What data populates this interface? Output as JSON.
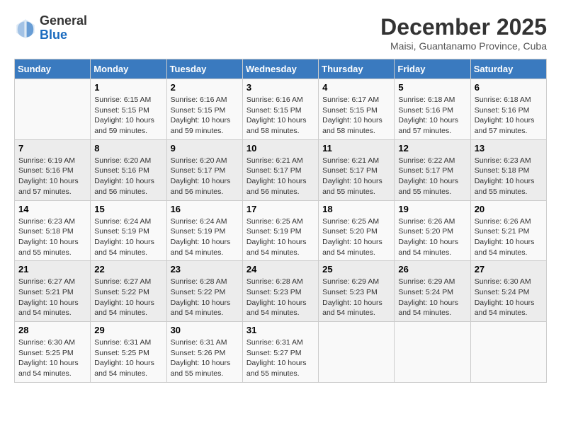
{
  "header": {
    "logo_general": "General",
    "logo_blue": "Blue",
    "title": "December 2025",
    "subtitle": "Maisi, Guantanamo Province, Cuba"
  },
  "days_of_week": [
    "Sunday",
    "Monday",
    "Tuesday",
    "Wednesday",
    "Thursday",
    "Friday",
    "Saturday"
  ],
  "weeks": [
    [
      {
        "day": "",
        "details": ""
      },
      {
        "day": "1",
        "details": "Sunrise: 6:15 AM\nSunset: 5:15 PM\nDaylight: 10 hours\nand 59 minutes."
      },
      {
        "day": "2",
        "details": "Sunrise: 6:16 AM\nSunset: 5:15 PM\nDaylight: 10 hours\nand 59 minutes."
      },
      {
        "day": "3",
        "details": "Sunrise: 6:16 AM\nSunset: 5:15 PM\nDaylight: 10 hours\nand 58 minutes."
      },
      {
        "day": "4",
        "details": "Sunrise: 6:17 AM\nSunset: 5:15 PM\nDaylight: 10 hours\nand 58 minutes."
      },
      {
        "day": "5",
        "details": "Sunrise: 6:18 AM\nSunset: 5:16 PM\nDaylight: 10 hours\nand 57 minutes."
      },
      {
        "day": "6",
        "details": "Sunrise: 6:18 AM\nSunset: 5:16 PM\nDaylight: 10 hours\nand 57 minutes."
      }
    ],
    [
      {
        "day": "7",
        "details": "Sunrise: 6:19 AM\nSunset: 5:16 PM\nDaylight: 10 hours\nand 57 minutes."
      },
      {
        "day": "8",
        "details": "Sunrise: 6:20 AM\nSunset: 5:16 PM\nDaylight: 10 hours\nand 56 minutes."
      },
      {
        "day": "9",
        "details": "Sunrise: 6:20 AM\nSunset: 5:17 PM\nDaylight: 10 hours\nand 56 minutes."
      },
      {
        "day": "10",
        "details": "Sunrise: 6:21 AM\nSunset: 5:17 PM\nDaylight: 10 hours\nand 56 minutes."
      },
      {
        "day": "11",
        "details": "Sunrise: 6:21 AM\nSunset: 5:17 PM\nDaylight: 10 hours\nand 55 minutes."
      },
      {
        "day": "12",
        "details": "Sunrise: 6:22 AM\nSunset: 5:17 PM\nDaylight: 10 hours\nand 55 minutes."
      },
      {
        "day": "13",
        "details": "Sunrise: 6:23 AM\nSunset: 5:18 PM\nDaylight: 10 hours\nand 55 minutes."
      }
    ],
    [
      {
        "day": "14",
        "details": "Sunrise: 6:23 AM\nSunset: 5:18 PM\nDaylight: 10 hours\nand 55 minutes."
      },
      {
        "day": "15",
        "details": "Sunrise: 6:24 AM\nSunset: 5:19 PM\nDaylight: 10 hours\nand 54 minutes."
      },
      {
        "day": "16",
        "details": "Sunrise: 6:24 AM\nSunset: 5:19 PM\nDaylight: 10 hours\nand 54 minutes."
      },
      {
        "day": "17",
        "details": "Sunrise: 6:25 AM\nSunset: 5:19 PM\nDaylight: 10 hours\nand 54 minutes."
      },
      {
        "day": "18",
        "details": "Sunrise: 6:25 AM\nSunset: 5:20 PM\nDaylight: 10 hours\nand 54 minutes."
      },
      {
        "day": "19",
        "details": "Sunrise: 6:26 AM\nSunset: 5:20 PM\nDaylight: 10 hours\nand 54 minutes."
      },
      {
        "day": "20",
        "details": "Sunrise: 6:26 AM\nSunset: 5:21 PM\nDaylight: 10 hours\nand 54 minutes."
      }
    ],
    [
      {
        "day": "21",
        "details": "Sunrise: 6:27 AM\nSunset: 5:21 PM\nDaylight: 10 hours\nand 54 minutes."
      },
      {
        "day": "22",
        "details": "Sunrise: 6:27 AM\nSunset: 5:22 PM\nDaylight: 10 hours\nand 54 minutes."
      },
      {
        "day": "23",
        "details": "Sunrise: 6:28 AM\nSunset: 5:22 PM\nDaylight: 10 hours\nand 54 minutes."
      },
      {
        "day": "24",
        "details": "Sunrise: 6:28 AM\nSunset: 5:23 PM\nDaylight: 10 hours\nand 54 minutes."
      },
      {
        "day": "25",
        "details": "Sunrise: 6:29 AM\nSunset: 5:23 PM\nDaylight: 10 hours\nand 54 minutes."
      },
      {
        "day": "26",
        "details": "Sunrise: 6:29 AM\nSunset: 5:24 PM\nDaylight: 10 hours\nand 54 minutes."
      },
      {
        "day": "27",
        "details": "Sunrise: 6:30 AM\nSunset: 5:24 PM\nDaylight: 10 hours\nand 54 minutes."
      }
    ],
    [
      {
        "day": "28",
        "details": "Sunrise: 6:30 AM\nSunset: 5:25 PM\nDaylight: 10 hours\nand 54 minutes."
      },
      {
        "day": "29",
        "details": "Sunrise: 6:31 AM\nSunset: 5:25 PM\nDaylight: 10 hours\nand 54 minutes."
      },
      {
        "day": "30",
        "details": "Sunrise: 6:31 AM\nSunset: 5:26 PM\nDaylight: 10 hours\nand 55 minutes."
      },
      {
        "day": "31",
        "details": "Sunrise: 6:31 AM\nSunset: 5:27 PM\nDaylight: 10 hours\nand 55 minutes."
      },
      {
        "day": "",
        "details": ""
      },
      {
        "day": "",
        "details": ""
      },
      {
        "day": "",
        "details": ""
      }
    ]
  ]
}
